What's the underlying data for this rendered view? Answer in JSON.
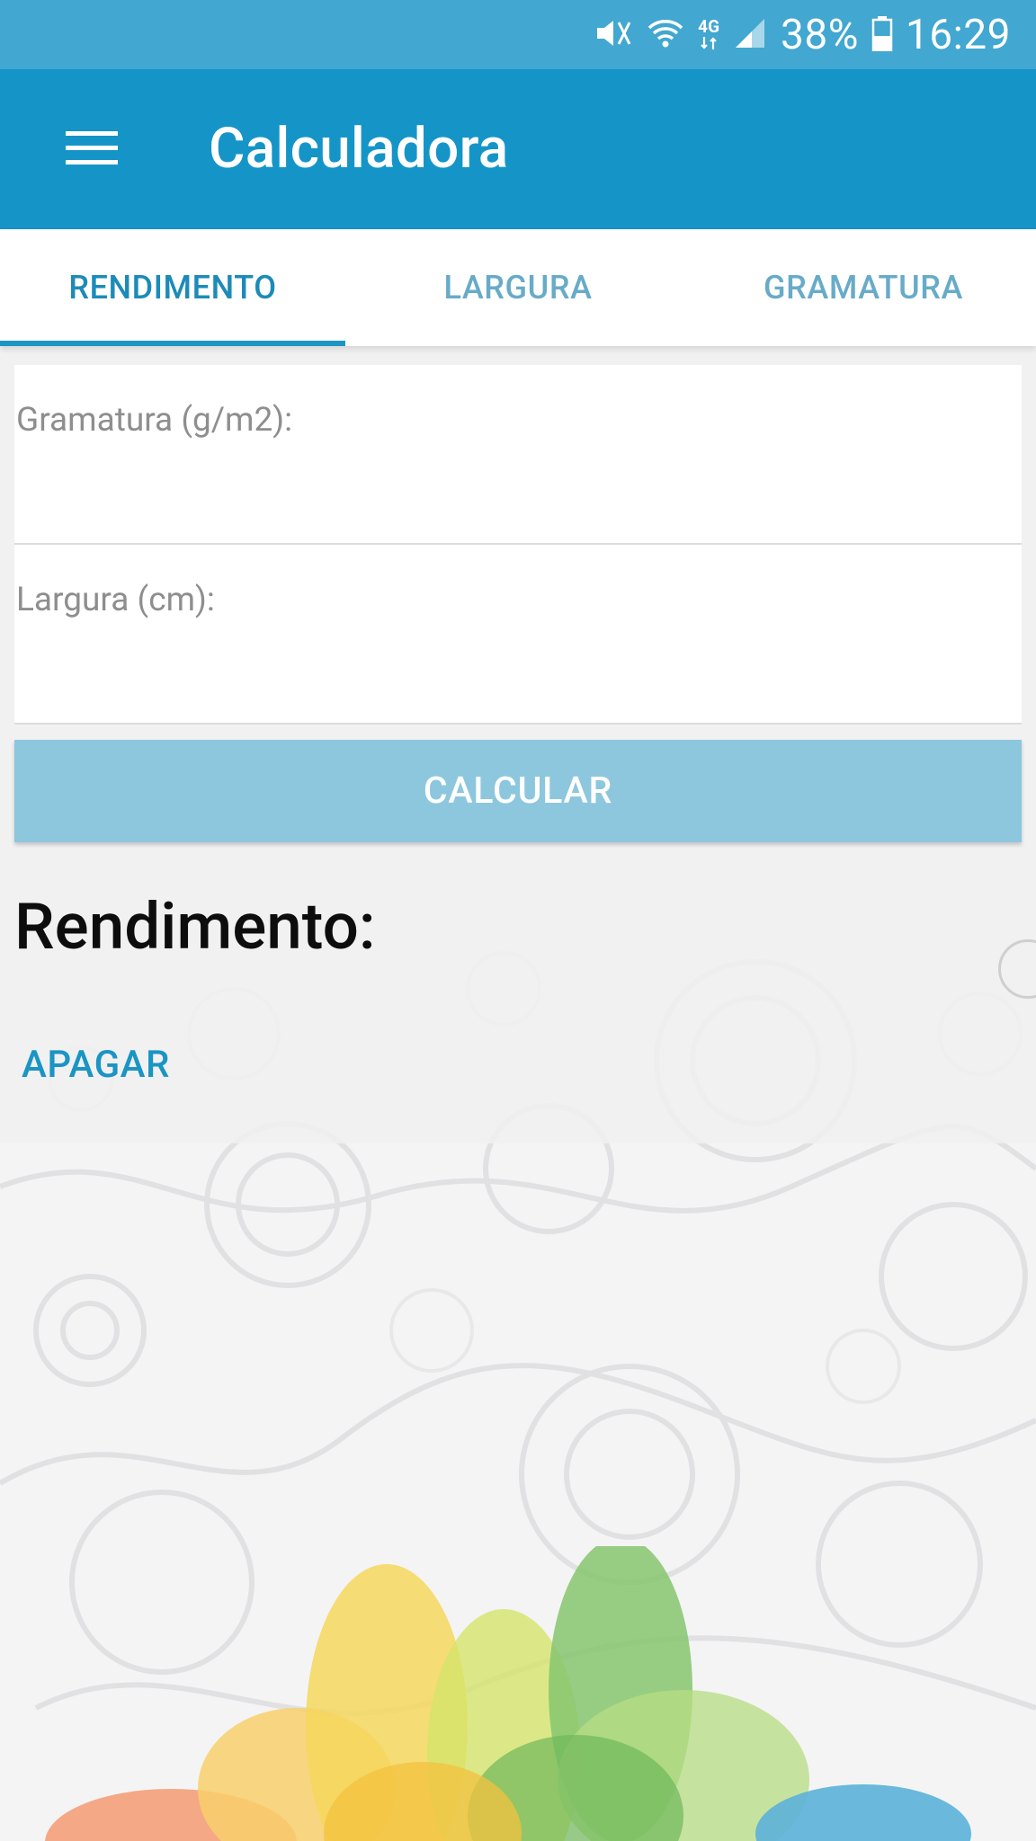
{
  "status_bar": {
    "battery_percent": "38%",
    "time": "16:29",
    "network_label": "4G",
    "icons": [
      "mute-icon",
      "wifi-icon",
      "network-4g-icon",
      "signal-icon",
      "battery-icon"
    ]
  },
  "app_bar": {
    "title": "Calculadora",
    "menu_icon": "hamburger-menu-icon"
  },
  "tabs": [
    {
      "label": "RENDIMENTO",
      "active": true
    },
    {
      "label": "LARGURA",
      "active": false
    },
    {
      "label": "GRAMATURA",
      "active": false
    }
  ],
  "form": {
    "gramatura_label": "Gramatura (g/m2):",
    "gramatura_value": "",
    "largura_label": "Largura (cm):",
    "largura_value": "",
    "calculate_label": "CALCULAR"
  },
  "result": {
    "label": "Rendimento:",
    "clear_label": "APAGAR"
  },
  "colors": {
    "status_bar": "#42a7d1",
    "app_bar": "#1595c7",
    "tab_active": "#1c8bb8",
    "tab_inactive": "#68abc8",
    "button": "#8dc7de"
  }
}
